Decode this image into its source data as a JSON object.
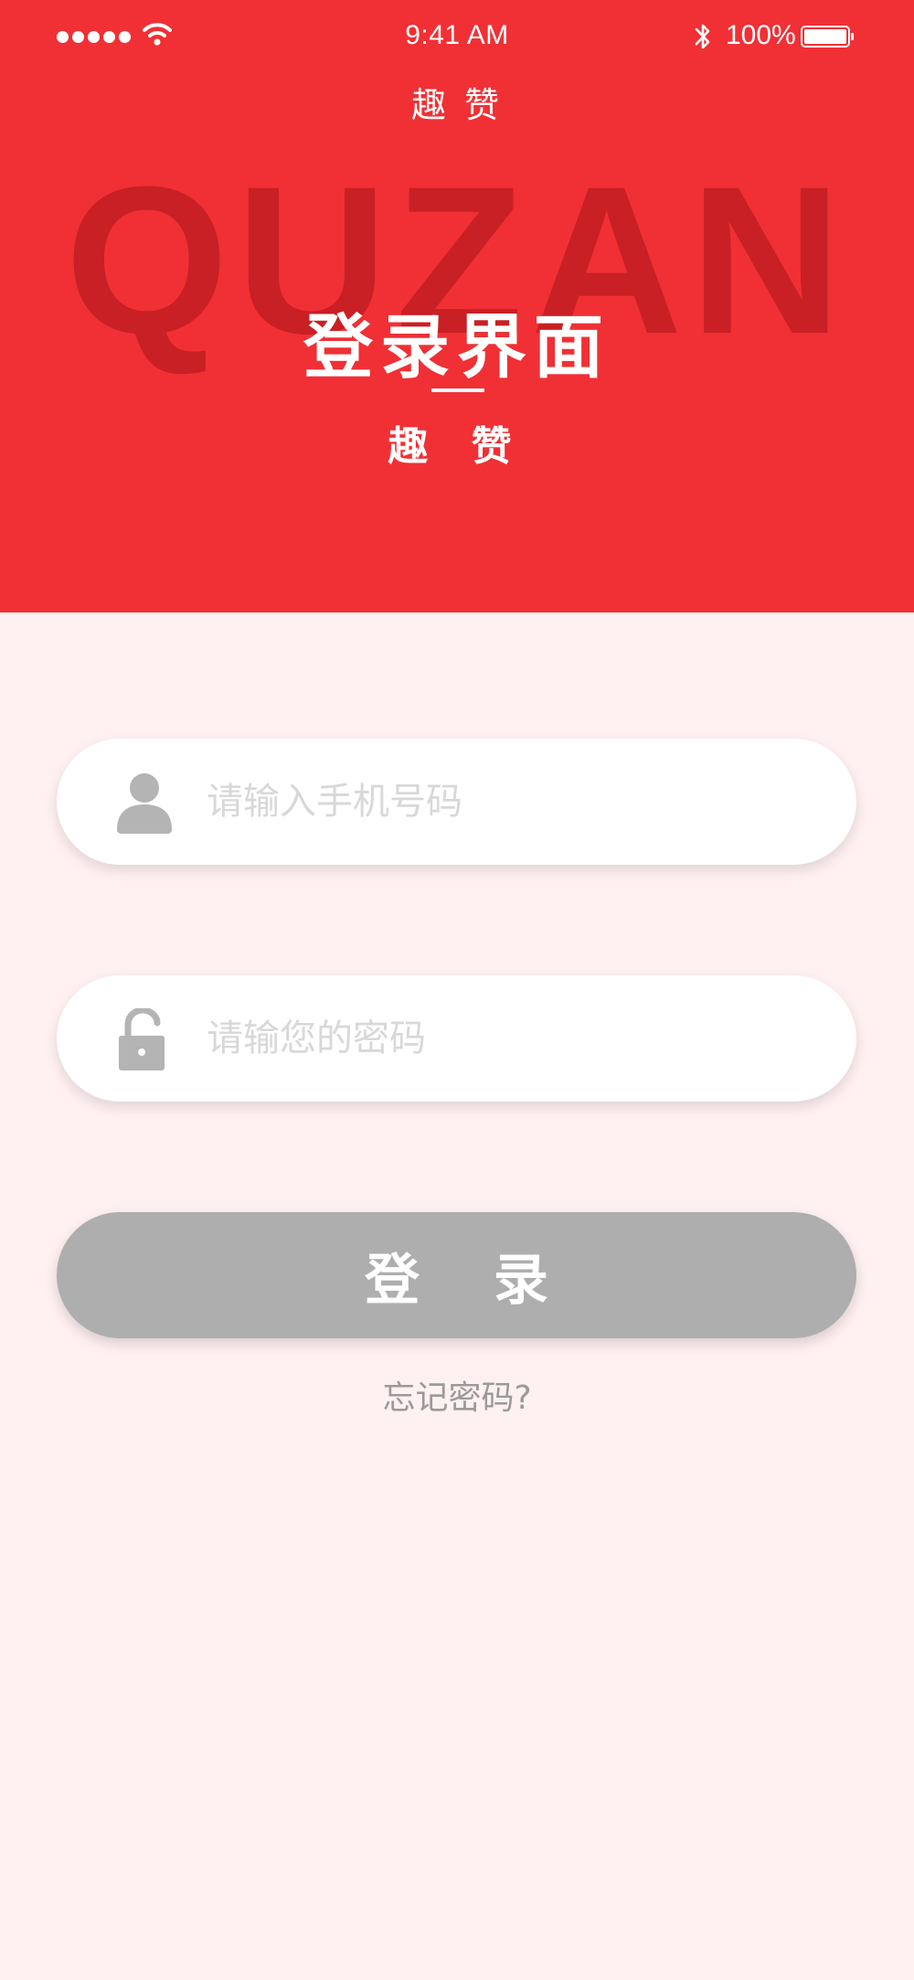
{
  "status_bar": {
    "time": "9:41 AM",
    "battery": "100%"
  },
  "header": {
    "app_title": "趣 赞",
    "watermark": "QUZAN",
    "title": "登录界面",
    "subtitle": "趣 赞"
  },
  "form": {
    "phone_placeholder": "请输入手机号码",
    "password_placeholder": "请输您的密码",
    "login_label": "登 录",
    "forgot_label": "忘记密码?"
  },
  "icons": {
    "phone": "user-icon",
    "password": "unlock-icon"
  },
  "colors": {
    "header_bg": "#F03035",
    "page_bg": "#FFF0F1",
    "watermark": "#C82024",
    "button_bg": "#AEAEAE",
    "icon": "#B4B4B4"
  }
}
